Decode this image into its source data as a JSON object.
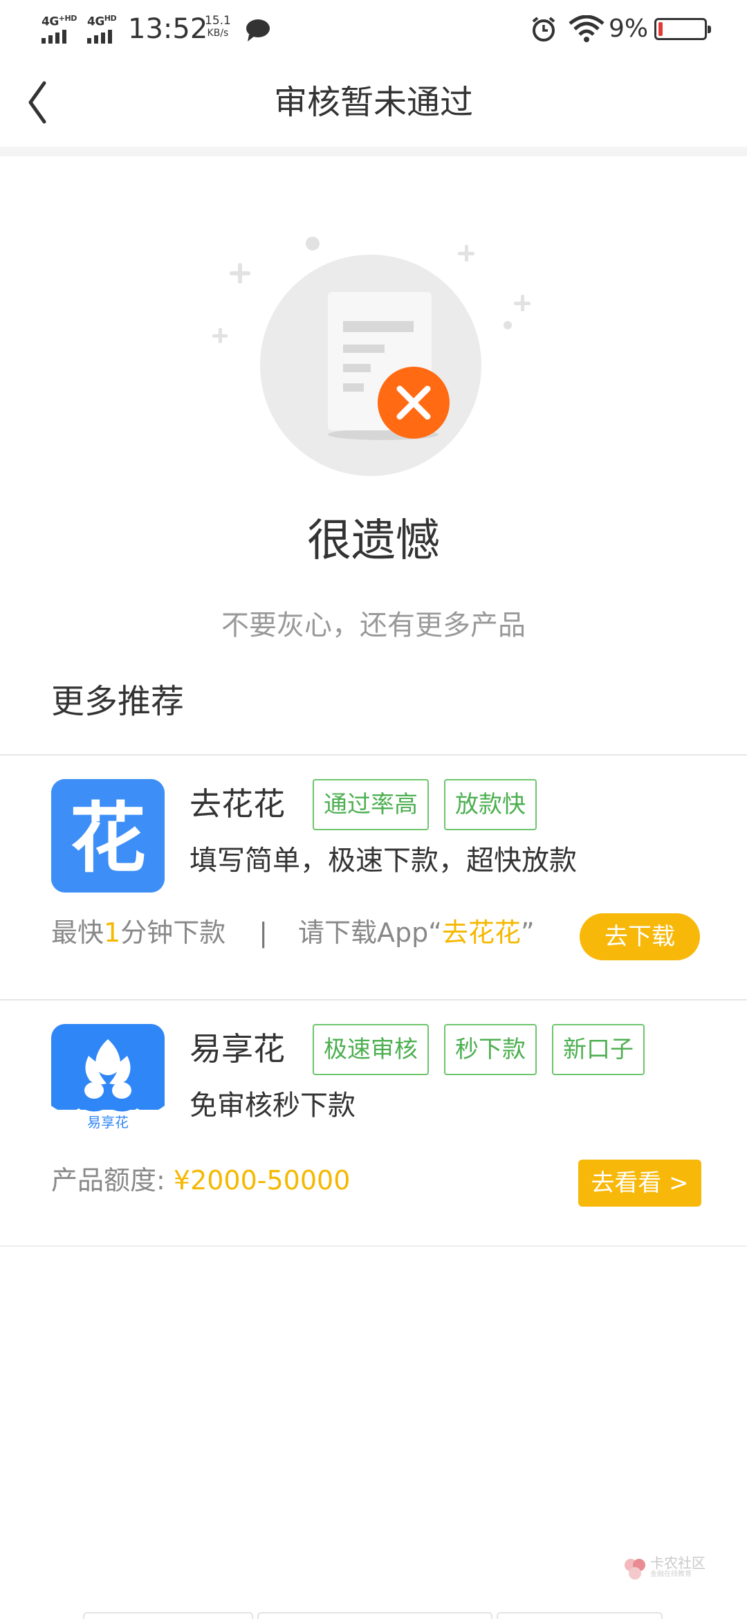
{
  "status_bar": {
    "net1": "4G",
    "net1_sup": "+HD",
    "net2": "4G",
    "net2_sup": "HD",
    "time": "13:52",
    "speed_value": "15.1",
    "speed_unit": "KB/s",
    "battery": "9%",
    "battery_level": 0.09,
    "battery_color": "#e53935"
  },
  "header": {
    "title": "审核暂未通过"
  },
  "result": {
    "title": "很遗憾",
    "subtitle": "不要灰心，还有更多产品",
    "accent_color": "#ff6a13"
  },
  "recommend": {
    "section_title": "更多推荐",
    "products": [
      {
        "name": "去花花",
        "icon_char": "花",
        "icon_color": "#3d8ff7",
        "tags": [
          "通过率高",
          "放款快"
        ],
        "desc": "填写简单，极速下款，超快放款",
        "foot_prefix": "最快",
        "foot_highlight": "1",
        "foot_suffix": "分钟下款",
        "foot_sep": "|",
        "foot_download_prefix": "请下载App“",
        "foot_download_name": "去花花",
        "foot_download_suffix": "”",
        "button_label": "去下载"
      },
      {
        "name": "易享花",
        "icon_caption": "易享花",
        "icon_color": "#2f86f6",
        "tags": [
          "极速审核",
          "秒下款",
          "新口子"
        ],
        "desc": "免审核秒下款",
        "amount_label": "产品额度: ",
        "amount_value": "¥2000-50000",
        "button_label": "去看看 >"
      }
    ]
  },
  "watermark": {
    "text": "卡农社区",
    "sub": "金融在线教育"
  },
  "colors": {
    "accent": "#f7b80a",
    "tag_green": "#4caf50",
    "highlight": "#f5b800"
  }
}
